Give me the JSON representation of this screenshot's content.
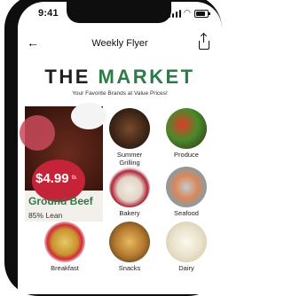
{
  "status_bar": {
    "time": "9:41"
  },
  "nav": {
    "title": "Weekly Flyer",
    "back_icon": "arrow-left-icon",
    "share_icon": "share-icon"
  },
  "header": {
    "brand_the": "THE",
    "brand_market": "MARKET",
    "tagline": "Your Favorite Brands at Value Prices!"
  },
  "feature": {
    "price": "$4.99",
    "unit": "lb.",
    "product": "Ground Beef",
    "detail": "85% Lean",
    "badge_color": "#c52438",
    "accent_color": "#2f7a48"
  },
  "categories": [
    {
      "label": "Summer Grilling"
    },
    {
      "label": "Produce"
    },
    {
      "label": "Bakery"
    },
    {
      "label": "Seafood"
    },
    {
      "label": "Breakfast"
    },
    {
      "label": "Snacks"
    },
    {
      "label": "Dairy"
    }
  ]
}
